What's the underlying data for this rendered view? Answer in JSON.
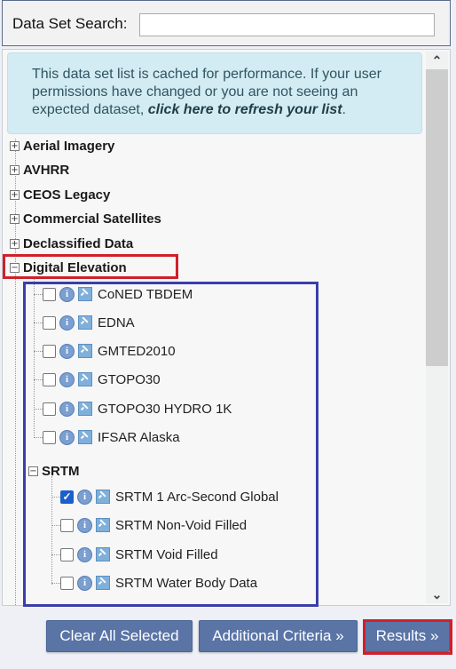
{
  "search": {
    "label": "Data Set Search:",
    "value": "",
    "placeholder": ""
  },
  "notice": {
    "text": "This data set list is cached for performance. If your user permissions have changed or you are not seeing an expected dataset, ",
    "link": "click here to refresh your list",
    "suffix": "."
  },
  "categories": [
    {
      "label": "Aerial Imagery",
      "expanded": false
    },
    {
      "label": "AVHRR",
      "expanded": false
    },
    {
      "label": "CEOS Legacy",
      "expanded": false
    },
    {
      "label": "Commercial Satellites",
      "expanded": false
    },
    {
      "label": "Declassified Data",
      "expanded": false
    },
    {
      "label": "Digital Elevation",
      "expanded": true
    }
  ],
  "digital_elevation": {
    "datasets": [
      {
        "label": "CoNED TBDEM",
        "checked": false
      },
      {
        "label": "EDNA",
        "checked": false
      },
      {
        "label": "GMTED2010",
        "checked": false
      },
      {
        "label": "GTOPO30",
        "checked": false
      },
      {
        "label": "GTOPO30 HYDRO 1K",
        "checked": false
      },
      {
        "label": "IFSAR Alaska",
        "checked": false
      }
    ],
    "srtm": {
      "label": "SRTM",
      "expanded": true,
      "datasets": [
        {
          "label": "SRTM 1 Arc-Second Global",
          "checked": true
        },
        {
          "label": "SRTM Non-Void Filled",
          "checked": false
        },
        {
          "label": "SRTM Void Filled",
          "checked": false
        },
        {
          "label": "SRTM Water Body Data",
          "checked": false
        }
      ]
    }
  },
  "icons": {
    "expand": "⊞",
    "collapse": "⊟",
    "check": "✓",
    "info": "i",
    "scroll_up": "^",
    "scroll_down": "v"
  },
  "buttons": {
    "clear": "Clear All Selected",
    "additional": "Additional Criteria »",
    "results": "Results »"
  },
  "colors": {
    "highlight_red": "#d0202a",
    "highlight_blue": "#3a3fa8",
    "button": "#5a74a6",
    "notice_bg": "#d3ebf3"
  }
}
